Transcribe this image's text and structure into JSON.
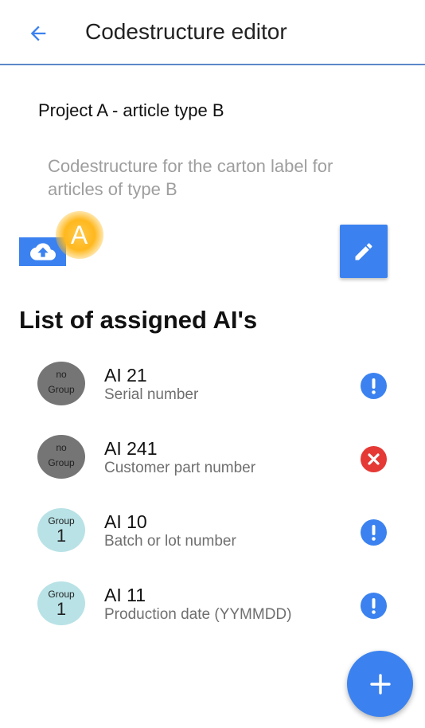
{
  "header": {
    "title": "Codestructure editor",
    "back_icon": "arrow-left-icon",
    "border_color": "#5b87c9"
  },
  "project": {
    "name": "Project A - article type B",
    "description": "Codestructure for the carton label for articles of type B"
  },
  "actions": {
    "upload_icon": "cloud-upload-icon",
    "edit_icon": "pencil-icon",
    "marker_label": "A"
  },
  "list": {
    "title": "List of assigned AI's",
    "items": [
      {
        "group_top": "no",
        "group_bottom": "Group",
        "group_kind": "none",
        "code": "AI 21",
        "description": "Serial number",
        "status": "info"
      },
      {
        "group_top": "no",
        "group_bottom": "Group",
        "group_kind": "none",
        "code": "AI 241",
        "description": "Customer part number",
        "status": "error"
      },
      {
        "group_top": "Group",
        "group_bottom": "1",
        "group_kind": "group",
        "code": "AI 10",
        "description": "Batch or lot number",
        "status": "info"
      },
      {
        "group_top": "Group",
        "group_bottom": "1",
        "group_kind": "group",
        "code": "AI 11",
        "description": "Production date (YYMMDD)",
        "status": "info"
      }
    ]
  },
  "fab": {
    "icon": "plus-icon"
  },
  "colors": {
    "accent": "#3b82f0",
    "error": "#e53935",
    "no_group": "#757575",
    "group": "#b8e2e6",
    "marker": "#ffb81e"
  }
}
